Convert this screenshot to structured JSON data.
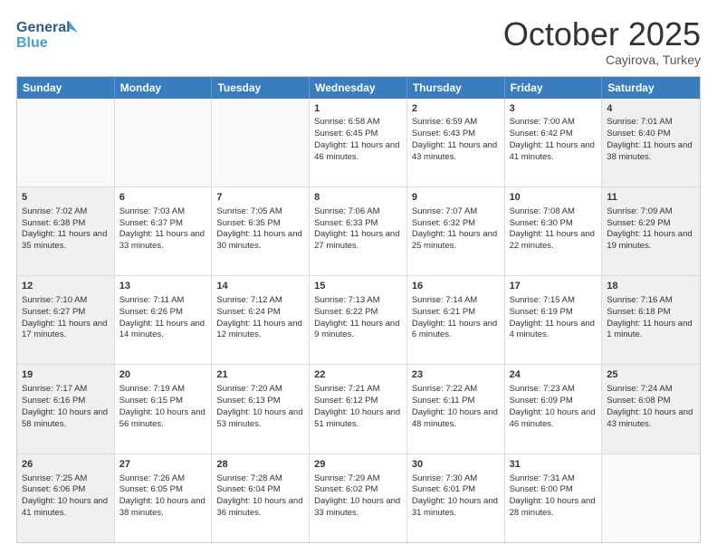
{
  "header": {
    "logo_line1": "General",
    "logo_line2": "Blue",
    "month": "October 2025",
    "location": "Cayirova, Turkey"
  },
  "weekdays": [
    "Sunday",
    "Monday",
    "Tuesday",
    "Wednesday",
    "Thursday",
    "Friday",
    "Saturday"
  ],
  "rows": [
    [
      {
        "day": "",
        "sunrise": "",
        "sunset": "",
        "daylight": "",
        "shaded": false,
        "empty": true
      },
      {
        "day": "",
        "sunrise": "",
        "sunset": "",
        "daylight": "",
        "shaded": false,
        "empty": true
      },
      {
        "day": "",
        "sunrise": "",
        "sunset": "",
        "daylight": "",
        "shaded": false,
        "empty": true
      },
      {
        "day": "1",
        "sunrise": "Sunrise: 6:58 AM",
        "sunset": "Sunset: 6:45 PM",
        "daylight": "Daylight: 11 hours and 46 minutes.",
        "shaded": false,
        "empty": false
      },
      {
        "day": "2",
        "sunrise": "Sunrise: 6:59 AM",
        "sunset": "Sunset: 6:43 PM",
        "daylight": "Daylight: 11 hours and 43 minutes.",
        "shaded": false,
        "empty": false
      },
      {
        "day": "3",
        "sunrise": "Sunrise: 7:00 AM",
        "sunset": "Sunset: 6:42 PM",
        "daylight": "Daylight: 11 hours and 41 minutes.",
        "shaded": false,
        "empty": false
      },
      {
        "day": "4",
        "sunrise": "Sunrise: 7:01 AM",
        "sunset": "Sunset: 6:40 PM",
        "daylight": "Daylight: 11 hours and 38 minutes.",
        "shaded": true,
        "empty": false
      }
    ],
    [
      {
        "day": "5",
        "sunrise": "Sunrise: 7:02 AM",
        "sunset": "Sunset: 6:38 PM",
        "daylight": "Daylight: 11 hours and 35 minutes.",
        "shaded": true,
        "empty": false
      },
      {
        "day": "6",
        "sunrise": "Sunrise: 7:03 AM",
        "sunset": "Sunset: 6:37 PM",
        "daylight": "Daylight: 11 hours and 33 minutes.",
        "shaded": false,
        "empty": false
      },
      {
        "day": "7",
        "sunrise": "Sunrise: 7:05 AM",
        "sunset": "Sunset: 6:35 PM",
        "daylight": "Daylight: 11 hours and 30 minutes.",
        "shaded": false,
        "empty": false
      },
      {
        "day": "8",
        "sunrise": "Sunrise: 7:06 AM",
        "sunset": "Sunset: 6:33 PM",
        "daylight": "Daylight: 11 hours and 27 minutes.",
        "shaded": false,
        "empty": false
      },
      {
        "day": "9",
        "sunrise": "Sunrise: 7:07 AM",
        "sunset": "Sunset: 6:32 PM",
        "daylight": "Daylight: 11 hours and 25 minutes.",
        "shaded": false,
        "empty": false
      },
      {
        "day": "10",
        "sunrise": "Sunrise: 7:08 AM",
        "sunset": "Sunset: 6:30 PM",
        "daylight": "Daylight: 11 hours and 22 minutes.",
        "shaded": false,
        "empty": false
      },
      {
        "day": "11",
        "sunrise": "Sunrise: 7:09 AM",
        "sunset": "Sunset: 6:29 PM",
        "daylight": "Daylight: 11 hours and 19 minutes.",
        "shaded": true,
        "empty": false
      }
    ],
    [
      {
        "day": "12",
        "sunrise": "Sunrise: 7:10 AM",
        "sunset": "Sunset: 6:27 PM",
        "daylight": "Daylight: 11 hours and 17 minutes.",
        "shaded": true,
        "empty": false
      },
      {
        "day": "13",
        "sunrise": "Sunrise: 7:11 AM",
        "sunset": "Sunset: 6:26 PM",
        "daylight": "Daylight: 11 hours and 14 minutes.",
        "shaded": false,
        "empty": false
      },
      {
        "day": "14",
        "sunrise": "Sunrise: 7:12 AM",
        "sunset": "Sunset: 6:24 PM",
        "daylight": "Daylight: 11 hours and 12 minutes.",
        "shaded": false,
        "empty": false
      },
      {
        "day": "15",
        "sunrise": "Sunrise: 7:13 AM",
        "sunset": "Sunset: 6:22 PM",
        "daylight": "Daylight: 11 hours and 9 minutes.",
        "shaded": false,
        "empty": false
      },
      {
        "day": "16",
        "sunrise": "Sunrise: 7:14 AM",
        "sunset": "Sunset: 6:21 PM",
        "daylight": "Daylight: 11 hours and 6 minutes.",
        "shaded": false,
        "empty": false
      },
      {
        "day": "17",
        "sunrise": "Sunrise: 7:15 AM",
        "sunset": "Sunset: 6:19 PM",
        "daylight": "Daylight: 11 hours and 4 minutes.",
        "shaded": false,
        "empty": false
      },
      {
        "day": "18",
        "sunrise": "Sunrise: 7:16 AM",
        "sunset": "Sunset: 6:18 PM",
        "daylight": "Daylight: 11 hours and 1 minute.",
        "shaded": true,
        "empty": false
      }
    ],
    [
      {
        "day": "19",
        "sunrise": "Sunrise: 7:17 AM",
        "sunset": "Sunset: 6:16 PM",
        "daylight": "Daylight: 10 hours and 58 minutes.",
        "shaded": true,
        "empty": false
      },
      {
        "day": "20",
        "sunrise": "Sunrise: 7:19 AM",
        "sunset": "Sunset: 6:15 PM",
        "daylight": "Daylight: 10 hours and 56 minutes.",
        "shaded": false,
        "empty": false
      },
      {
        "day": "21",
        "sunrise": "Sunrise: 7:20 AM",
        "sunset": "Sunset: 6:13 PM",
        "daylight": "Daylight: 10 hours and 53 minutes.",
        "shaded": false,
        "empty": false
      },
      {
        "day": "22",
        "sunrise": "Sunrise: 7:21 AM",
        "sunset": "Sunset: 6:12 PM",
        "daylight": "Daylight: 10 hours and 51 minutes.",
        "shaded": false,
        "empty": false
      },
      {
        "day": "23",
        "sunrise": "Sunrise: 7:22 AM",
        "sunset": "Sunset: 6:11 PM",
        "daylight": "Daylight: 10 hours and 48 minutes.",
        "shaded": false,
        "empty": false
      },
      {
        "day": "24",
        "sunrise": "Sunrise: 7:23 AM",
        "sunset": "Sunset: 6:09 PM",
        "daylight": "Daylight: 10 hours and 46 minutes.",
        "shaded": false,
        "empty": false
      },
      {
        "day": "25",
        "sunrise": "Sunrise: 7:24 AM",
        "sunset": "Sunset: 6:08 PM",
        "daylight": "Daylight: 10 hours and 43 minutes.",
        "shaded": true,
        "empty": false
      }
    ],
    [
      {
        "day": "26",
        "sunrise": "Sunrise: 7:25 AM",
        "sunset": "Sunset: 6:06 PM",
        "daylight": "Daylight: 10 hours and 41 minutes.",
        "shaded": true,
        "empty": false
      },
      {
        "day": "27",
        "sunrise": "Sunrise: 7:26 AM",
        "sunset": "Sunset: 6:05 PM",
        "daylight": "Daylight: 10 hours and 38 minutes.",
        "shaded": false,
        "empty": false
      },
      {
        "day": "28",
        "sunrise": "Sunrise: 7:28 AM",
        "sunset": "Sunset: 6:04 PM",
        "daylight": "Daylight: 10 hours and 36 minutes.",
        "shaded": false,
        "empty": false
      },
      {
        "day": "29",
        "sunrise": "Sunrise: 7:29 AM",
        "sunset": "Sunset: 6:02 PM",
        "daylight": "Daylight: 10 hours and 33 minutes.",
        "shaded": false,
        "empty": false
      },
      {
        "day": "30",
        "sunrise": "Sunrise: 7:30 AM",
        "sunset": "Sunset: 6:01 PM",
        "daylight": "Daylight: 10 hours and 31 minutes.",
        "shaded": false,
        "empty": false
      },
      {
        "day": "31",
        "sunrise": "Sunrise: 7:31 AM",
        "sunset": "Sunset: 6:00 PM",
        "daylight": "Daylight: 10 hours and 28 minutes.",
        "shaded": false,
        "empty": false
      },
      {
        "day": "",
        "sunrise": "",
        "sunset": "",
        "daylight": "",
        "shaded": true,
        "empty": true
      }
    ]
  ]
}
